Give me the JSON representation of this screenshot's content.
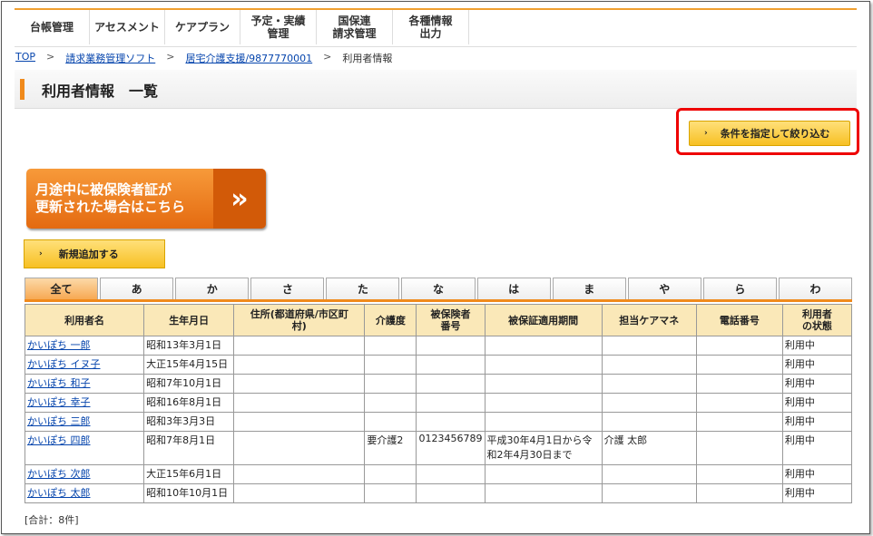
{
  "nav": [
    {
      "label": "台帳管理"
    },
    {
      "label": "アセスメント"
    },
    {
      "label": "ケアプラン"
    },
    {
      "label": "予定・実績\n管理"
    },
    {
      "label": "国保連\n請求管理"
    },
    {
      "label": "各種情報\n出力"
    }
  ],
  "breadcrumb": {
    "top": "TOP",
    "sep": ">",
    "software": "請求業務管理ソフト",
    "office": "居宅介護支援/9877770001",
    "current": "利用者情報"
  },
  "page_title": "利用者情報　一覧",
  "filter_button": "条件を指定して絞り込む",
  "banner": {
    "text": "月途中に被保険者証が\n更新された場合はこちら",
    "arrow": "»"
  },
  "add_button": "新規追加する",
  "arrow_glyph": "›",
  "tabs": [
    "全て",
    "あ",
    "か",
    "さ",
    "た",
    "な",
    "は",
    "ま",
    "や",
    "ら",
    "わ"
  ],
  "table": {
    "headers": [
      "利用者名",
      "生年月日",
      "住所(都道府県/市区町\n村)",
      "介護度",
      "被保険者\n番号",
      "被保証適用期間",
      "担当ケアマネ",
      "電話番号",
      "利用者\nの状態"
    ],
    "rows": [
      {
        "name": "かいぽち 一郎",
        "birth": "昭和13年3月1日",
        "address": "",
        "level": "",
        "insured_no": "",
        "period": "",
        "manager": "",
        "phone": "",
        "status": "利用中"
      },
      {
        "name": "かいぽち イヌ子",
        "birth": "大正15年4月15日",
        "address": "",
        "level": "",
        "insured_no": "",
        "period": "",
        "manager": "",
        "phone": "",
        "status": "利用中"
      },
      {
        "name": "かいぽち 和子",
        "birth": "昭和7年10月1日",
        "address": "",
        "level": "",
        "insured_no": "",
        "period": "",
        "manager": "",
        "phone": "",
        "status": "利用中"
      },
      {
        "name": "かいぽち 幸子",
        "birth": "昭和16年8月1日",
        "address": "",
        "level": "",
        "insured_no": "",
        "period": "",
        "manager": "",
        "phone": "",
        "status": "利用中"
      },
      {
        "name": "かいぽち 三郎",
        "birth": "昭和3年3月3日",
        "address": "",
        "level": "",
        "insured_no": "",
        "period": "",
        "manager": "",
        "phone": "",
        "status": "利用中"
      },
      {
        "name": "かいぽち 四郎",
        "birth": "昭和7年8月1日",
        "address": "",
        "level": "要介護2",
        "insured_no": "0123456789",
        "period": "平成30年4月1日から令和2年4月30日まで",
        "manager": "介護 太郎",
        "phone": "",
        "status": "利用中"
      },
      {
        "name": "かいぽち 次郎",
        "birth": "大正15年6月1日",
        "address": "",
        "level": "",
        "insured_no": "",
        "period": "",
        "manager": "",
        "phone": "",
        "status": "利用中"
      },
      {
        "name": "かいぽち 太郎",
        "birth": "昭和10年10月1日",
        "address": "",
        "level": "",
        "insured_no": "",
        "period": "",
        "manager": "",
        "phone": "",
        "status": "利用中"
      }
    ]
  },
  "total": "[合計：8件]",
  "colors": {
    "accent": "#f08a1c",
    "header_bg": "#fae8b8",
    "button": "#f7c023",
    "highlight": "#e00000",
    "link": "#0645ad"
  }
}
